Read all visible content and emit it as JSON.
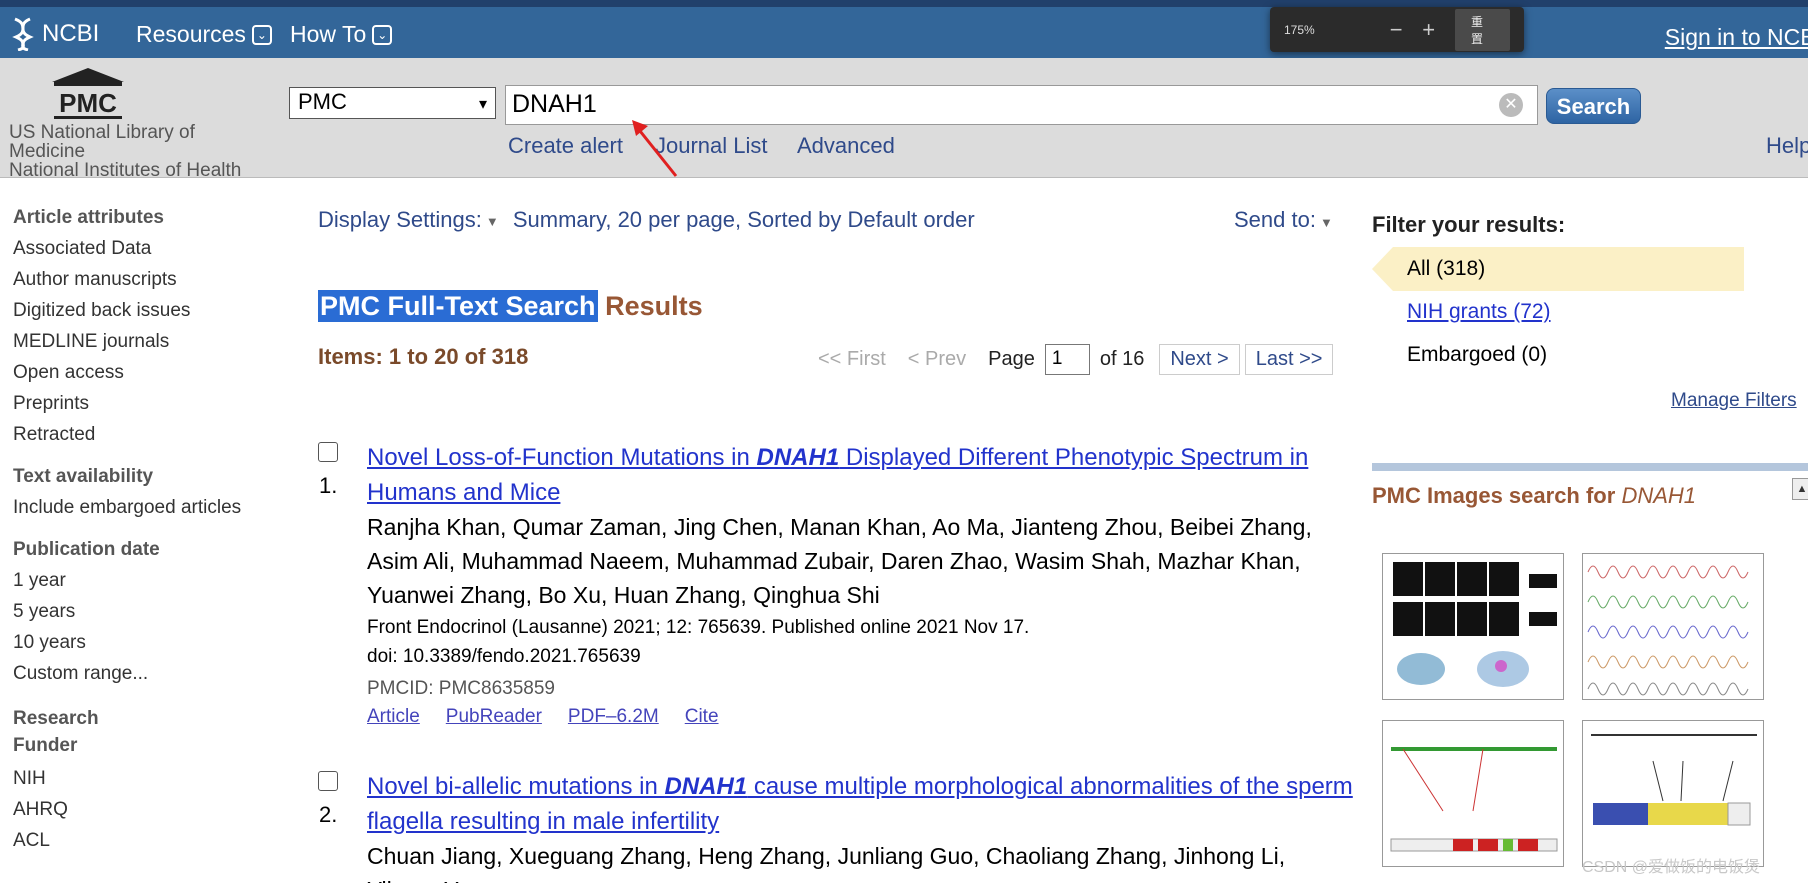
{
  "topbar": {
    "logo_text": "NCBI",
    "nav": [
      {
        "label": "Resources"
      },
      {
        "label": "How To"
      }
    ],
    "signin": "Sign in to NCBI"
  },
  "zoom_popup": {
    "level": "175%",
    "minus": "−",
    "plus": "+",
    "reset": "重置"
  },
  "searchband": {
    "pmc_logo_text": "PMC",
    "lib_line1": "US National Library of",
    "lib_line2": "Medicine",
    "lib_line3": "National Institutes of Health",
    "database": "PMC",
    "query": "DNAH1",
    "search_button": "Search",
    "links": {
      "create_alert": "Create alert",
      "journal_list": "Journal List",
      "advanced": "Advanced",
      "help": "Help"
    }
  },
  "sidebar": {
    "sections": [
      {
        "head": "Article attributes",
        "items": [
          "Associated Data",
          "Author manuscripts",
          "Digitized back issues",
          "MEDLINE journals",
          "Open access",
          "Preprints",
          "Retracted"
        ]
      },
      {
        "head": "Text availability",
        "items": [
          "Include embargoed articles"
        ]
      },
      {
        "head": "Publication date",
        "items": [
          "1 year",
          "5 years",
          "10 years",
          "Custom range..."
        ]
      },
      {
        "head": "Research Funder",
        "items": [
          "NIH",
          "AHRQ",
          "ACL"
        ]
      }
    ]
  },
  "main": {
    "display_settings_label": "Display Settings:",
    "display_settings_value": "Summary, 20 per page, Sorted by Default order",
    "send_to": "Send to:",
    "results_title_hl": "PMC Full-Text Search",
    "results_title_rest": " Results",
    "items_text": "Items: 1 to 20 of 318",
    "pager": {
      "first": "<< First",
      "prev": "< Prev",
      "page_label": "Page",
      "page_value": "1",
      "of": "of 16",
      "next": "Next >",
      "last": "Last >>"
    },
    "results": [
      {
        "num": "1.",
        "title_pre": "Novel Loss-of-Function Mutations in ",
        "title_term": "DNAH1",
        "title_post": " Displayed Different Phenotypic Spectrum in Humans and Mice",
        "authors": "Ranjha Khan, Qumar Zaman, Jing Chen, Manan Khan, Ao Ma, Jianteng Zhou, Beibei Zhang, Asim Ali, Muhammad Naeem, Muhammad Zubair, Daren Zhao, Wasim Shah, Mazhar Khan, Yuanwei Zhang, Bo Xu, Huan Zhang, Qinghua Shi",
        "citation": "Front Endocrinol (Lausanne) 2021; 12: 765639. Published online 2021 Nov 17.",
        "doi": "doi: 10.3389/fendo.2021.765639",
        "pmcid": "PMCID: PMC8635859",
        "links": [
          "Article",
          "PubReader",
          "PDF–6.2M",
          "Cite"
        ]
      },
      {
        "num": "2.",
        "title_pre": "Novel bi-allelic mutations in ",
        "title_term": "DNAH1",
        "title_post": " cause multiple morphological abnormalities of the sperm flagella resulting in male infertility",
        "authors": "Chuan Jiang, Xueguang Zhang, Heng Zhang, Junliang Guo, Chaoliang Zhang, Jinhong Li, Yihong Yang"
      }
    ]
  },
  "filters": {
    "head": "Filter your results:",
    "all": "All (318)",
    "nih": "NIH grants (72)",
    "embargoed": "Embargoed (0)",
    "manage": "Manage Filters"
  },
  "images": {
    "title": "PMC Images search for ",
    "term": "DNAH1"
  },
  "watermark": "CSDN @爱做饭的电饭煲"
}
